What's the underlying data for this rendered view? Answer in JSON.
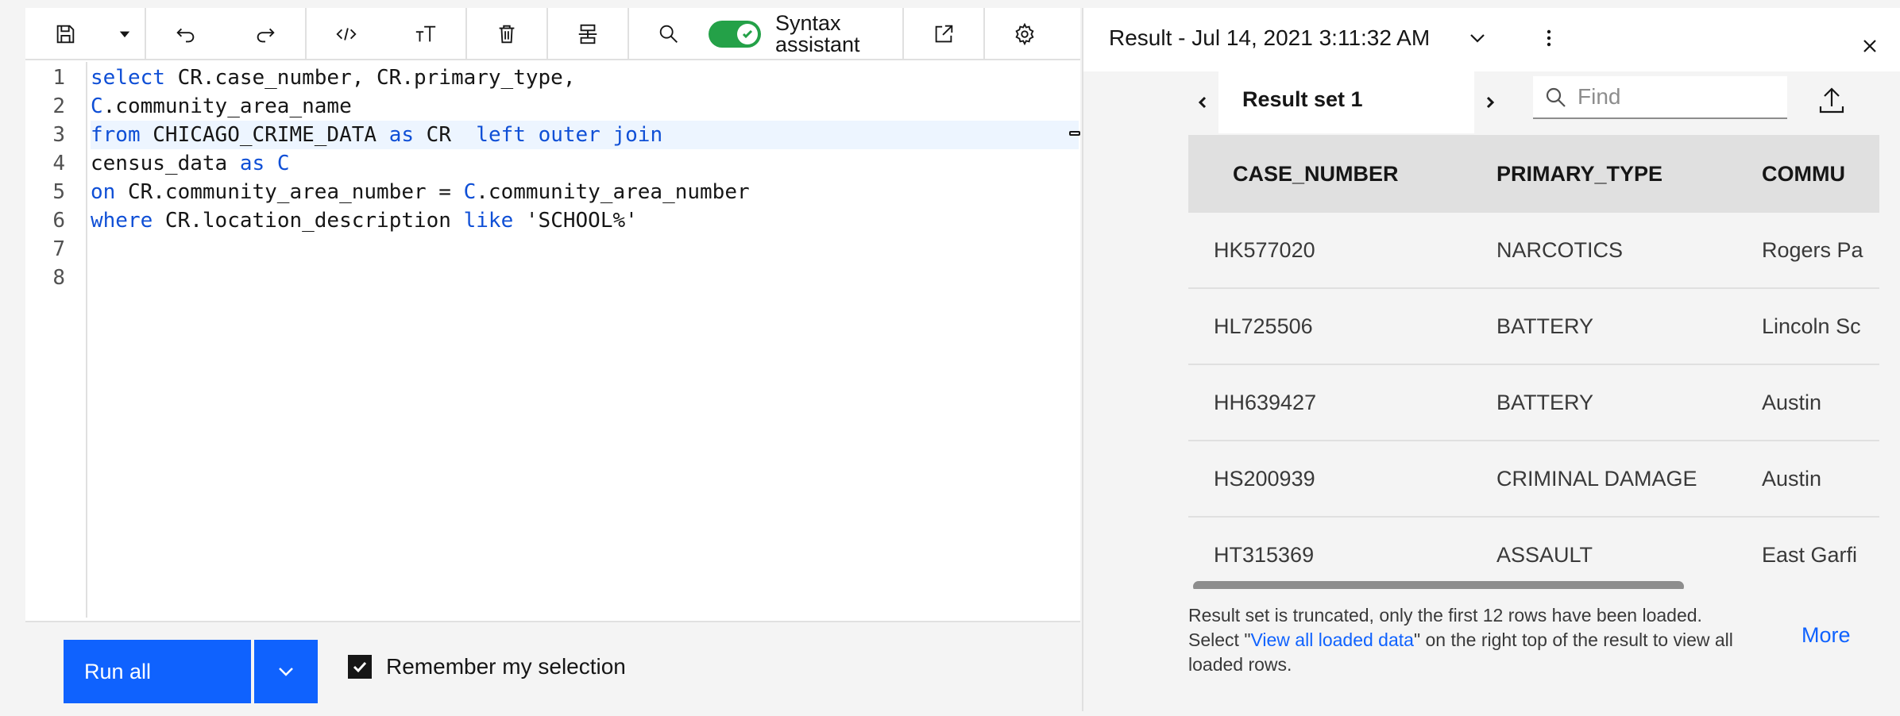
{
  "toolbar": {
    "toggle_label": "Syntax assistant",
    "toggle_on": true
  },
  "editor": {
    "lines": [
      {
        "no": "1",
        "segments": [
          {
            "t": "select",
            "k": true
          },
          {
            "t": " CR.case_number, CR.primary_type,",
            "k": false
          }
        ]
      },
      {
        "no": "2",
        "segments": [
          {
            "t": "C",
            "k": true
          },
          {
            "t": ".community_area_name",
            "k": false
          }
        ]
      },
      {
        "no": "3",
        "segments": [
          {
            "t": "from",
            "k": true
          },
          {
            "t": " CHICAGO_CRIME_DATA ",
            "k": false
          },
          {
            "t": "as",
            "k": true
          },
          {
            "t": " CR  ",
            "k": false
          },
          {
            "t": "left outer join",
            "k": true
          }
        ],
        "active": true
      },
      {
        "no": "4",
        "segments": [
          {
            "t": "census_data ",
            "k": false
          },
          {
            "t": "as",
            "k": true
          },
          {
            "t": " ",
            "k": false
          },
          {
            "t": "C",
            "k": true
          }
        ]
      },
      {
        "no": "5",
        "segments": [
          {
            "t": "on",
            "k": true
          },
          {
            "t": " CR.community_area_number = ",
            "k": false
          },
          {
            "t": "C",
            "k": true
          },
          {
            "t": ".community_area_number",
            "k": false
          }
        ]
      },
      {
        "no": "6",
        "segments": [
          {
            "t": "where",
            "k": true
          },
          {
            "t": " CR.location_description ",
            "k": false
          },
          {
            "t": "like",
            "k": true
          },
          {
            "t": " 'SCHOOL%'",
            "k": false
          }
        ]
      },
      {
        "no": "7",
        "segments": []
      },
      {
        "no": "8",
        "segments": []
      }
    ]
  },
  "run": {
    "run_label": "Run all",
    "remember_label": "Remember my selection",
    "remember_checked": true
  },
  "result": {
    "title": "Result - Jul 14, 2021 3:11:32 AM",
    "tab_label": "Result set 1",
    "find_placeholder": "Find",
    "columns": [
      "CASE_NUMBER",
      "PRIMARY_TYPE",
      "COMMU"
    ],
    "rows": [
      [
        "HK577020",
        "NARCOTICS",
        "Rogers Pa"
      ],
      [
        "HL725506",
        "BATTERY",
        "Lincoln Sc"
      ],
      [
        "HH639427",
        "BATTERY",
        "Austin"
      ],
      [
        "HS200939",
        "CRIMINAL DAMAGE",
        "Austin"
      ],
      [
        "HT315369",
        "ASSAULT",
        "East Garfi"
      ]
    ],
    "notice_1": "Result set is truncated, only the first 12 rows have been loaded.",
    "notice_2_pre": "Select \"",
    "notice_link": "View all loaded data",
    "notice_2_post": "\" on the right top of the result to view all loaded rows.",
    "more_label": "More"
  },
  "colors": {
    "accent": "#0f62fe",
    "keyword": "#0f4fd6",
    "toggle_on": "#24a148"
  }
}
